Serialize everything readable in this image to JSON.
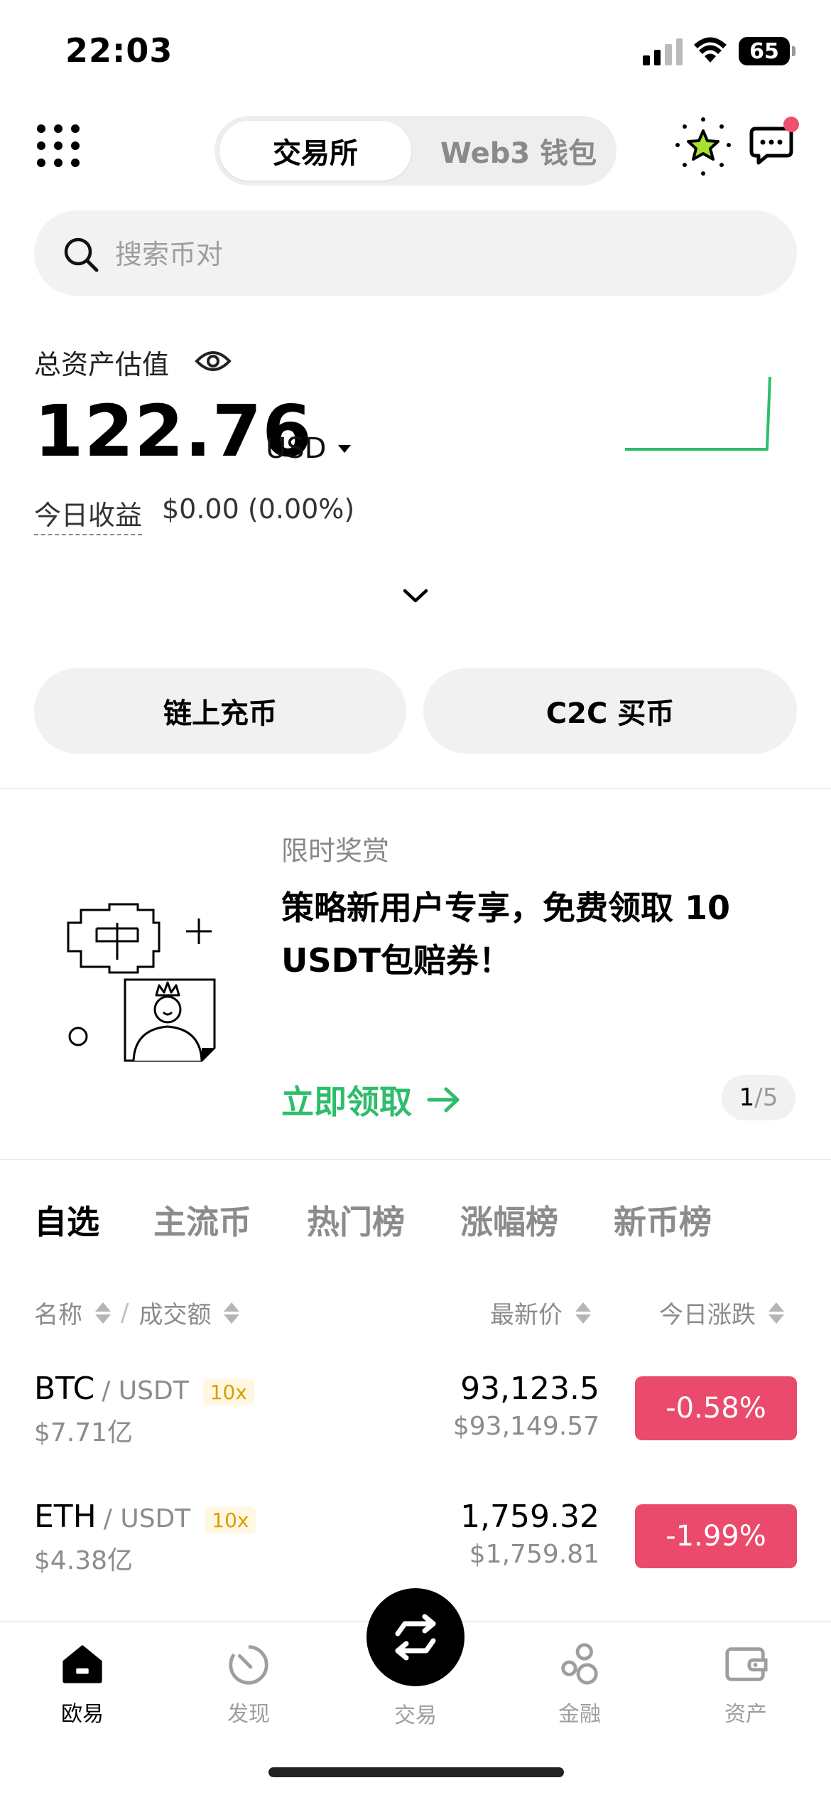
{
  "status_bar": {
    "time": "22:03",
    "battery": "65"
  },
  "header": {
    "tabs": [
      {
        "label": "交易所",
        "active": true
      },
      {
        "label": "Web3 钱包",
        "active": false
      }
    ]
  },
  "search": {
    "placeholder": "搜索币对"
  },
  "assets": {
    "label": "总资产估值",
    "value": "122.76",
    "currency": "USD",
    "pnl_label": "今日收益",
    "pnl_value": "$0.00 (0.00%)"
  },
  "actions": {
    "deposit": "链上充币",
    "c2c": "C2C 买币"
  },
  "promo": {
    "tag": "限时奖赏",
    "title": "策略新用户专享，免费领取 10 USDT包赔券！",
    "cta": "立即领取",
    "page_current": "1",
    "page_total": "/5"
  },
  "market": {
    "tabs": [
      "自选",
      "主流币",
      "热门榜",
      "涨幅榜",
      "新币榜"
    ],
    "columns": {
      "name": "名称",
      "sep": "/",
      "volume": "成交额",
      "price": "最新价",
      "change": "今日涨跌"
    },
    "rows": [
      {
        "base": "BTC",
        "quote": "/ USDT",
        "leverage": "10x",
        "volume": "$7.71亿",
        "price": "93,123.5",
        "price_usd": "$93,149.57",
        "change": "-0.58%"
      },
      {
        "base": "ETH",
        "quote": "/ USDT",
        "leverage": "10x",
        "volume": "$4.38亿",
        "price": "1,759.32",
        "price_usd": "$1,759.81",
        "change": "-1.99%"
      }
    ]
  },
  "bottom_nav": {
    "items": [
      {
        "label": "欧易",
        "icon": "home-icon",
        "active": true
      },
      {
        "label": "发现",
        "icon": "discover-icon",
        "active": false
      },
      {
        "label": "交易",
        "icon": "swap-icon",
        "active": false
      },
      {
        "label": "金融",
        "icon": "finance-icon",
        "active": false
      },
      {
        "label": "资产",
        "icon": "wallet-icon",
        "active": false
      }
    ]
  },
  "colors": {
    "accent_green": "#2ebd6b",
    "down_red": "#ea4b6d",
    "notification": "#f0506e"
  }
}
